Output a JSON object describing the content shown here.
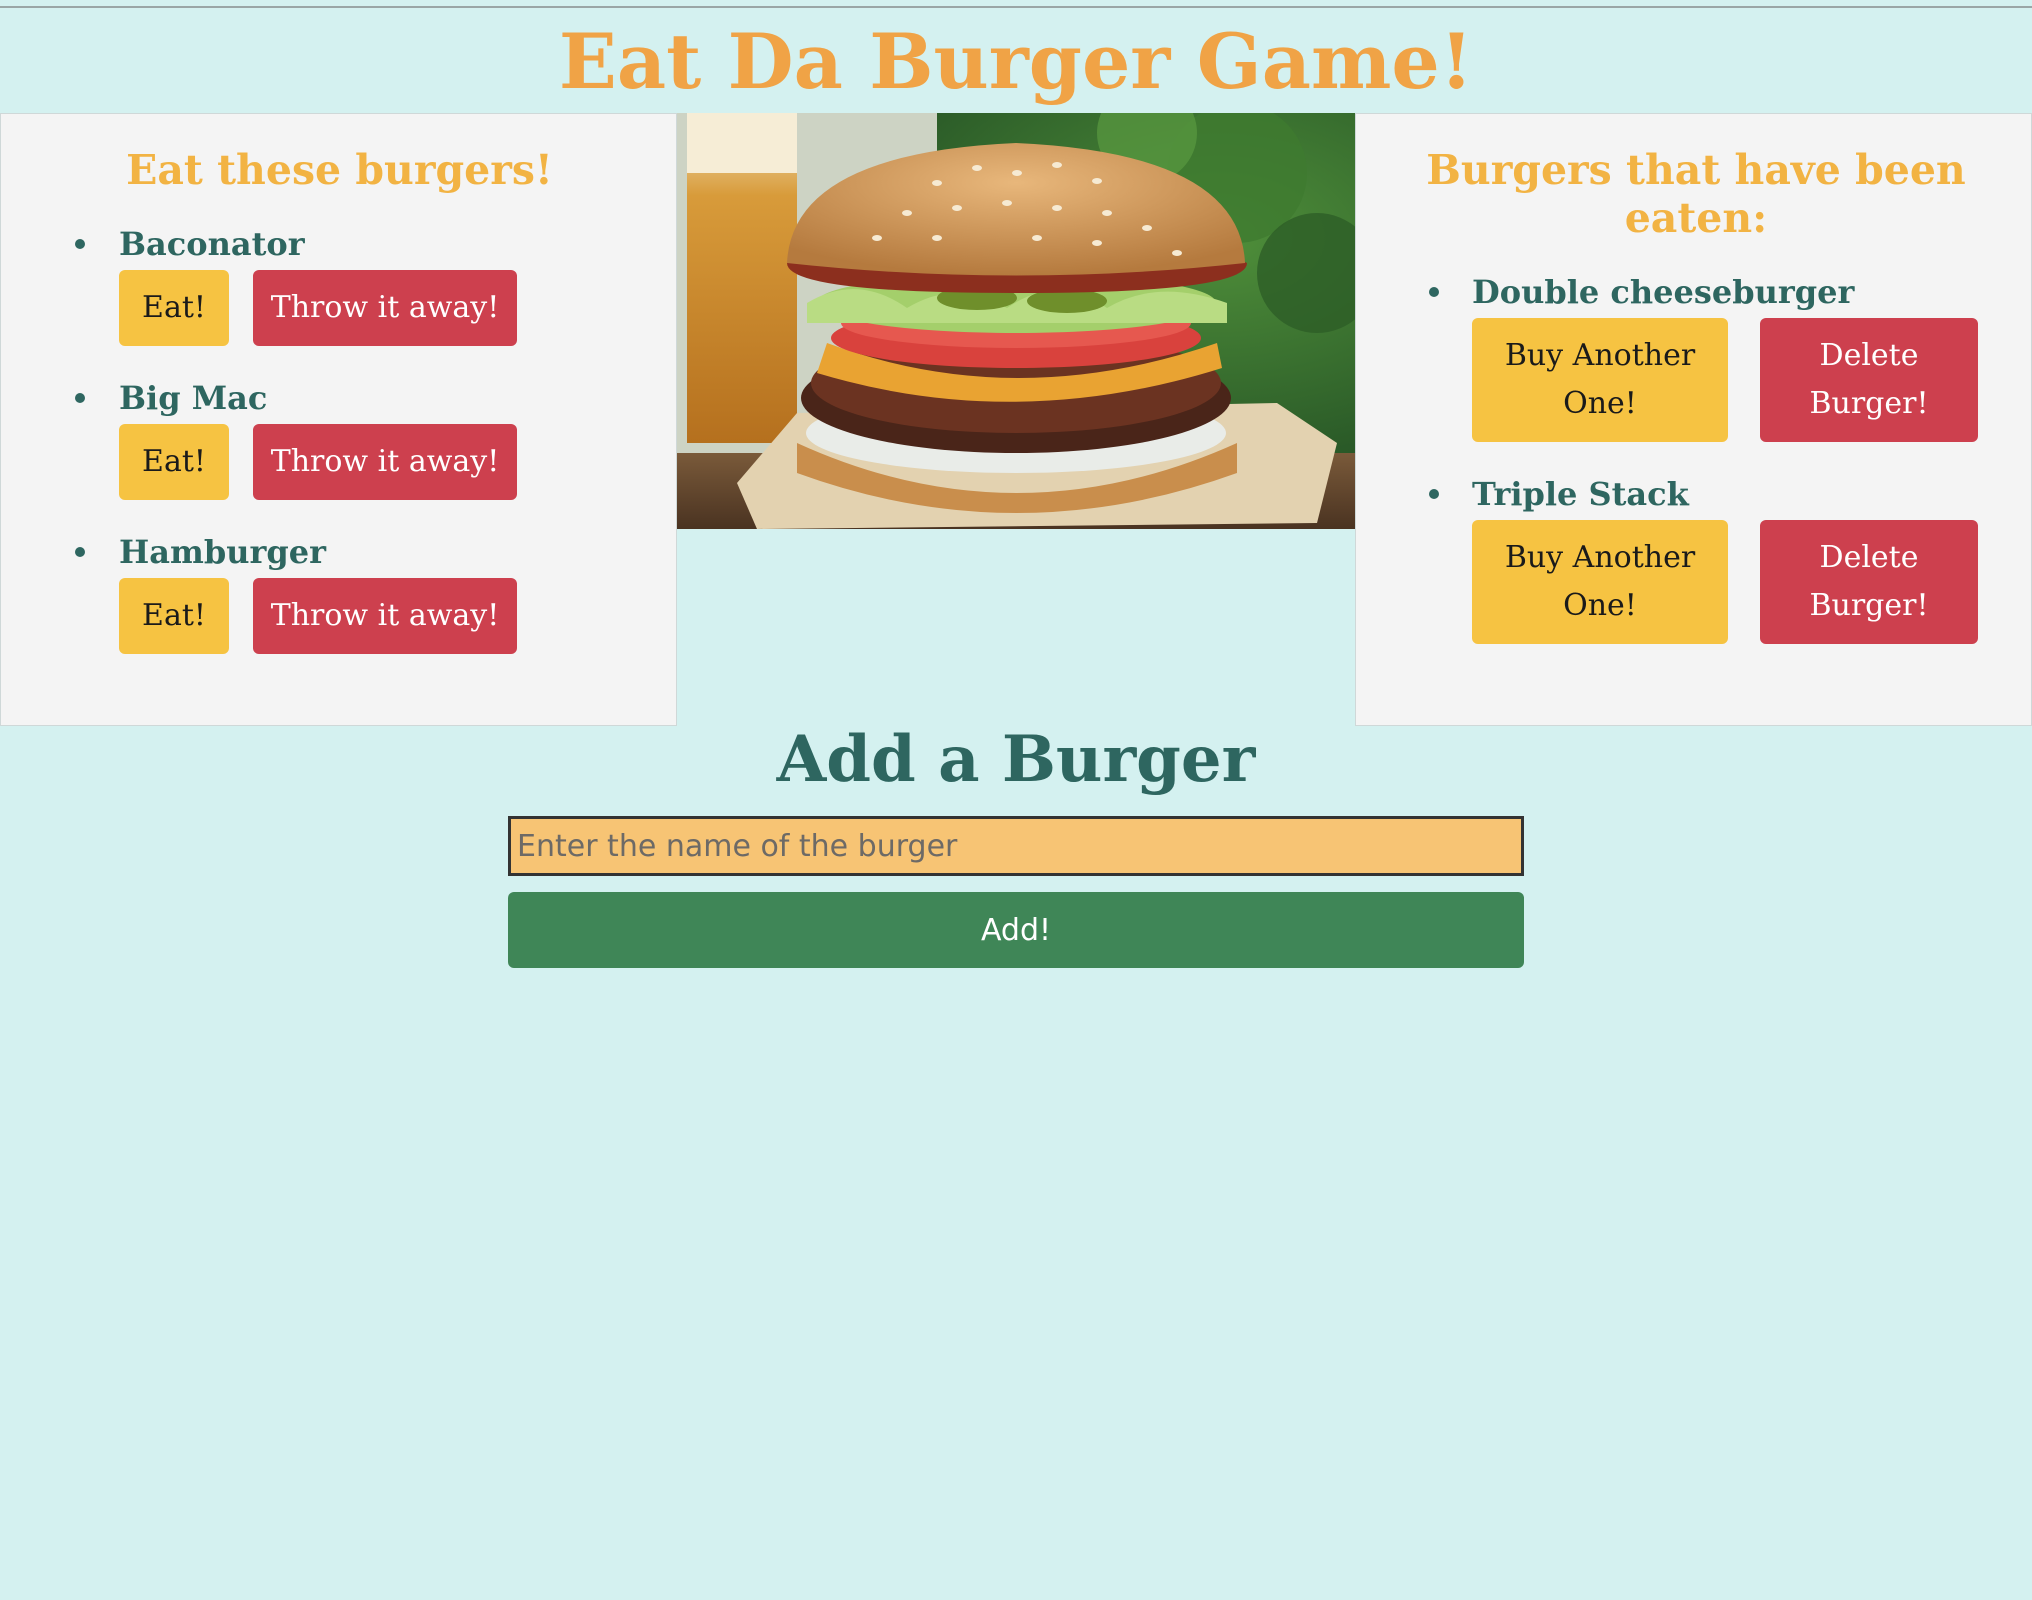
{
  "app": {
    "title": "Eat Da Burger Game!"
  },
  "uneaten": {
    "heading": "Eat these burgers!",
    "items": [
      {
        "name": "Baconator",
        "eat_label": "Eat!",
        "throw_label": "Throw it away!"
      },
      {
        "name": "Big Mac",
        "eat_label": "Eat!",
        "throw_label": "Throw it away!"
      },
      {
        "name": "Hamburger",
        "eat_label": "Eat!",
        "throw_label": "Throw it away!"
      }
    ]
  },
  "eaten": {
    "heading": "Burgers that have been eaten:",
    "items": [
      {
        "name": "Double cheeseburger",
        "buy_label_line1": "Buy Another",
        "buy_label_line2": "One!",
        "delete_label_line1": "Delete",
        "delete_label_line2": "Burger!"
      },
      {
        "name": "Triple Stack",
        "buy_label_line1": "Buy Another",
        "buy_label_line2": "One!",
        "delete_label_line1": "Delete",
        "delete_label_line2": "Burger!"
      }
    ]
  },
  "add_form": {
    "heading": "Add a Burger",
    "placeholder": "Enter the name of the burger",
    "button_label": "Add!"
  },
  "colors": {
    "background": "#d4f1f0",
    "title": "#f0a346",
    "panel_heading": "#f2b343",
    "burger_name": "#2e6660",
    "eat_button": "#f6c342",
    "throw_button": "#cd404e",
    "add_button": "#3f8657",
    "input_background": "#f7c474"
  }
}
